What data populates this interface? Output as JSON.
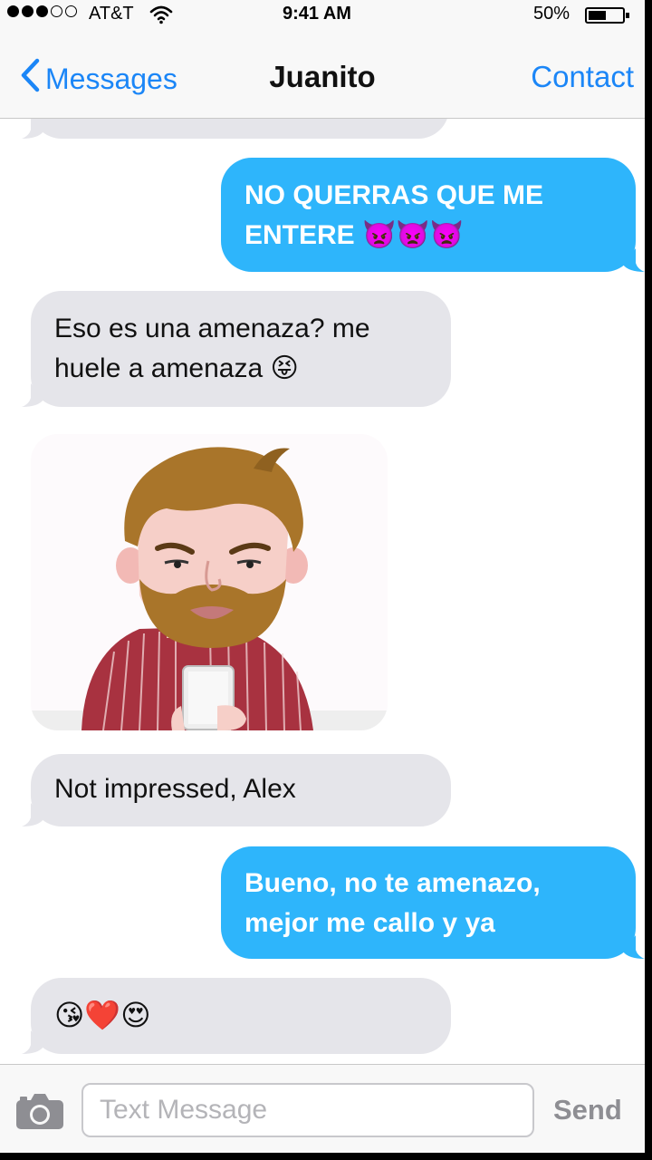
{
  "status_bar": {
    "carrier": "AT&T",
    "time": "9:41 AM",
    "battery_percent": "50%",
    "signal_bars_filled": 3,
    "signal_bars_total": 5,
    "battery_level": 0.5
  },
  "nav": {
    "back_label": "Messages",
    "title": "Juanito",
    "contact_label": "Contact"
  },
  "messages": [
    {
      "direction": "incoming",
      "text": ""
    },
    {
      "direction": "outgoing",
      "lines": [
        "NO QUERRAS QUE ME",
        "ENTERE"
      ],
      "emoji": "👿👿👿"
    },
    {
      "direction": "incoming",
      "lines": [
        "Eso es una amenaza? me",
        "huele a amenaza"
      ],
      "emoji": "😝"
    },
    {
      "direction": "incoming",
      "type": "image",
      "image": "illustration-bearded-man-holding-phone"
    },
    {
      "direction": "incoming",
      "lines": [
        "Not impressed, Alex"
      ]
    },
    {
      "direction": "outgoing",
      "lines": [
        "Bueno, no te amenazo,",
        "mejor me callo y ya"
      ]
    },
    {
      "direction": "incoming",
      "emoji": "😘❤️😍"
    }
  ],
  "input": {
    "placeholder": "Text Message",
    "value": "",
    "send_label": "Send",
    "camera_icon": "camera-icon"
  },
  "colors": {
    "accent": "#1b86f7",
    "outgoing_bubble": "#2eb5fb",
    "incoming_bubble": "#e5e5ea",
    "send_disabled": "#8e8e93"
  }
}
